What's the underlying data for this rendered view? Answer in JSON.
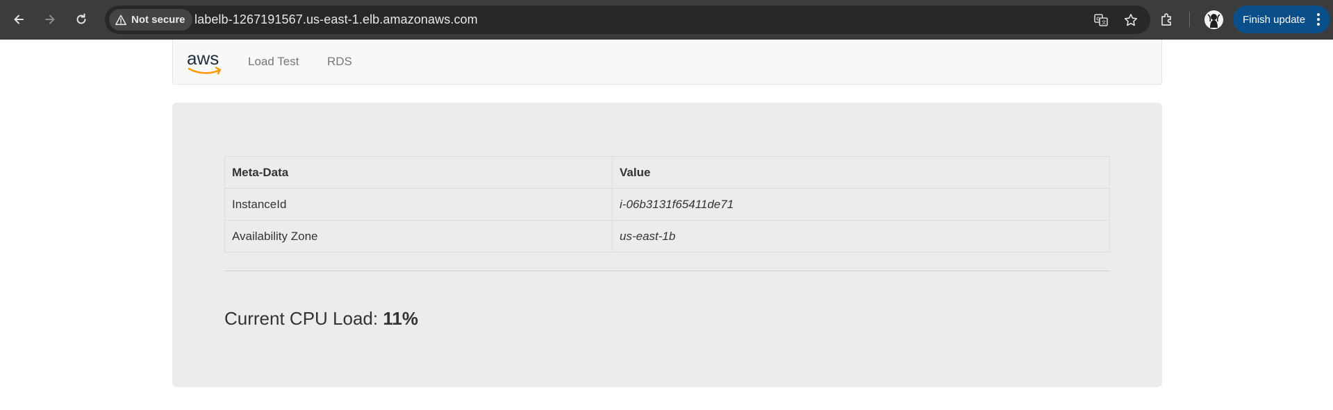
{
  "browser": {
    "security_label": "Not secure",
    "url": "labelb-1267191567.us-east-1.elb.amazonaws.com",
    "finish_update_label": "Finish update",
    "icons": [
      "back-icon",
      "forward-icon",
      "reload-icon",
      "warning-icon",
      "translate-icon",
      "star-icon",
      "extensions-icon",
      "avatar",
      "more-icon"
    ]
  },
  "navbar": {
    "logo_text": "aws",
    "links": [
      "Load Test",
      "RDS"
    ]
  },
  "table": {
    "headers": [
      "Meta-Data",
      "Value"
    ],
    "rows": [
      [
        "InstanceId",
        "i-06b3131f65411de71"
      ],
      [
        "Availability Zone",
        "us-east-1b"
      ]
    ]
  },
  "cpu": {
    "label": "Current CPU Load: ",
    "value": "11%"
  }
}
